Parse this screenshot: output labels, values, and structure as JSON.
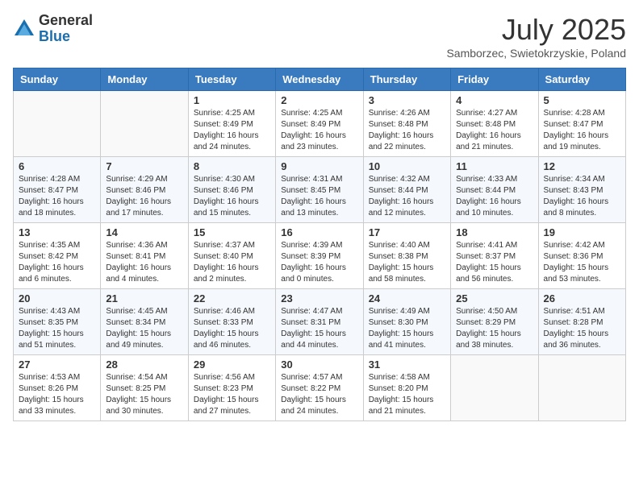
{
  "logo": {
    "general": "General",
    "blue": "Blue"
  },
  "title": "July 2025",
  "subtitle": "Samborzec, Swietokrzyskie, Poland",
  "days_of_week": [
    "Sunday",
    "Monday",
    "Tuesday",
    "Wednesday",
    "Thursday",
    "Friday",
    "Saturday"
  ],
  "weeks": [
    [
      {
        "day": "",
        "sunrise": "",
        "sunset": "",
        "daylight": ""
      },
      {
        "day": "",
        "sunrise": "",
        "sunset": "",
        "daylight": ""
      },
      {
        "day": "1",
        "sunrise": "Sunrise: 4:25 AM",
        "sunset": "Sunset: 8:49 PM",
        "daylight": "Daylight: 16 hours and 24 minutes."
      },
      {
        "day": "2",
        "sunrise": "Sunrise: 4:25 AM",
        "sunset": "Sunset: 8:49 PM",
        "daylight": "Daylight: 16 hours and 23 minutes."
      },
      {
        "day": "3",
        "sunrise": "Sunrise: 4:26 AM",
        "sunset": "Sunset: 8:48 PM",
        "daylight": "Daylight: 16 hours and 22 minutes."
      },
      {
        "day": "4",
        "sunrise": "Sunrise: 4:27 AM",
        "sunset": "Sunset: 8:48 PM",
        "daylight": "Daylight: 16 hours and 21 minutes."
      },
      {
        "day": "5",
        "sunrise": "Sunrise: 4:28 AM",
        "sunset": "Sunset: 8:47 PM",
        "daylight": "Daylight: 16 hours and 19 minutes."
      }
    ],
    [
      {
        "day": "6",
        "sunrise": "Sunrise: 4:28 AM",
        "sunset": "Sunset: 8:47 PM",
        "daylight": "Daylight: 16 hours and 18 minutes."
      },
      {
        "day": "7",
        "sunrise": "Sunrise: 4:29 AM",
        "sunset": "Sunset: 8:46 PM",
        "daylight": "Daylight: 16 hours and 17 minutes."
      },
      {
        "day": "8",
        "sunrise": "Sunrise: 4:30 AM",
        "sunset": "Sunset: 8:46 PM",
        "daylight": "Daylight: 16 hours and 15 minutes."
      },
      {
        "day": "9",
        "sunrise": "Sunrise: 4:31 AM",
        "sunset": "Sunset: 8:45 PM",
        "daylight": "Daylight: 16 hours and 13 minutes."
      },
      {
        "day": "10",
        "sunrise": "Sunrise: 4:32 AM",
        "sunset": "Sunset: 8:44 PM",
        "daylight": "Daylight: 16 hours and 12 minutes."
      },
      {
        "day": "11",
        "sunrise": "Sunrise: 4:33 AM",
        "sunset": "Sunset: 8:44 PM",
        "daylight": "Daylight: 16 hours and 10 minutes."
      },
      {
        "day": "12",
        "sunrise": "Sunrise: 4:34 AM",
        "sunset": "Sunset: 8:43 PM",
        "daylight": "Daylight: 16 hours and 8 minutes."
      }
    ],
    [
      {
        "day": "13",
        "sunrise": "Sunrise: 4:35 AM",
        "sunset": "Sunset: 8:42 PM",
        "daylight": "Daylight: 16 hours and 6 minutes."
      },
      {
        "day": "14",
        "sunrise": "Sunrise: 4:36 AM",
        "sunset": "Sunset: 8:41 PM",
        "daylight": "Daylight: 16 hours and 4 minutes."
      },
      {
        "day": "15",
        "sunrise": "Sunrise: 4:37 AM",
        "sunset": "Sunset: 8:40 PM",
        "daylight": "Daylight: 16 hours and 2 minutes."
      },
      {
        "day": "16",
        "sunrise": "Sunrise: 4:39 AM",
        "sunset": "Sunset: 8:39 PM",
        "daylight": "Daylight: 16 hours and 0 minutes."
      },
      {
        "day": "17",
        "sunrise": "Sunrise: 4:40 AM",
        "sunset": "Sunset: 8:38 PM",
        "daylight": "Daylight: 15 hours and 58 minutes."
      },
      {
        "day": "18",
        "sunrise": "Sunrise: 4:41 AM",
        "sunset": "Sunset: 8:37 PM",
        "daylight": "Daylight: 15 hours and 56 minutes."
      },
      {
        "day": "19",
        "sunrise": "Sunrise: 4:42 AM",
        "sunset": "Sunset: 8:36 PM",
        "daylight": "Daylight: 15 hours and 53 minutes."
      }
    ],
    [
      {
        "day": "20",
        "sunrise": "Sunrise: 4:43 AM",
        "sunset": "Sunset: 8:35 PM",
        "daylight": "Daylight: 15 hours and 51 minutes."
      },
      {
        "day": "21",
        "sunrise": "Sunrise: 4:45 AM",
        "sunset": "Sunset: 8:34 PM",
        "daylight": "Daylight: 15 hours and 49 minutes."
      },
      {
        "day": "22",
        "sunrise": "Sunrise: 4:46 AM",
        "sunset": "Sunset: 8:33 PM",
        "daylight": "Daylight: 15 hours and 46 minutes."
      },
      {
        "day": "23",
        "sunrise": "Sunrise: 4:47 AM",
        "sunset": "Sunset: 8:31 PM",
        "daylight": "Daylight: 15 hours and 44 minutes."
      },
      {
        "day": "24",
        "sunrise": "Sunrise: 4:49 AM",
        "sunset": "Sunset: 8:30 PM",
        "daylight": "Daylight: 15 hours and 41 minutes."
      },
      {
        "day": "25",
        "sunrise": "Sunrise: 4:50 AM",
        "sunset": "Sunset: 8:29 PM",
        "daylight": "Daylight: 15 hours and 38 minutes."
      },
      {
        "day": "26",
        "sunrise": "Sunrise: 4:51 AM",
        "sunset": "Sunset: 8:28 PM",
        "daylight": "Daylight: 15 hours and 36 minutes."
      }
    ],
    [
      {
        "day": "27",
        "sunrise": "Sunrise: 4:53 AM",
        "sunset": "Sunset: 8:26 PM",
        "daylight": "Daylight: 15 hours and 33 minutes."
      },
      {
        "day": "28",
        "sunrise": "Sunrise: 4:54 AM",
        "sunset": "Sunset: 8:25 PM",
        "daylight": "Daylight: 15 hours and 30 minutes."
      },
      {
        "day": "29",
        "sunrise": "Sunrise: 4:56 AM",
        "sunset": "Sunset: 8:23 PM",
        "daylight": "Daylight: 15 hours and 27 minutes."
      },
      {
        "day": "30",
        "sunrise": "Sunrise: 4:57 AM",
        "sunset": "Sunset: 8:22 PM",
        "daylight": "Daylight: 15 hours and 24 minutes."
      },
      {
        "day": "31",
        "sunrise": "Sunrise: 4:58 AM",
        "sunset": "Sunset: 8:20 PM",
        "daylight": "Daylight: 15 hours and 21 minutes."
      },
      {
        "day": "",
        "sunrise": "",
        "sunset": "",
        "daylight": ""
      },
      {
        "day": "",
        "sunrise": "",
        "sunset": "",
        "daylight": ""
      }
    ]
  ]
}
